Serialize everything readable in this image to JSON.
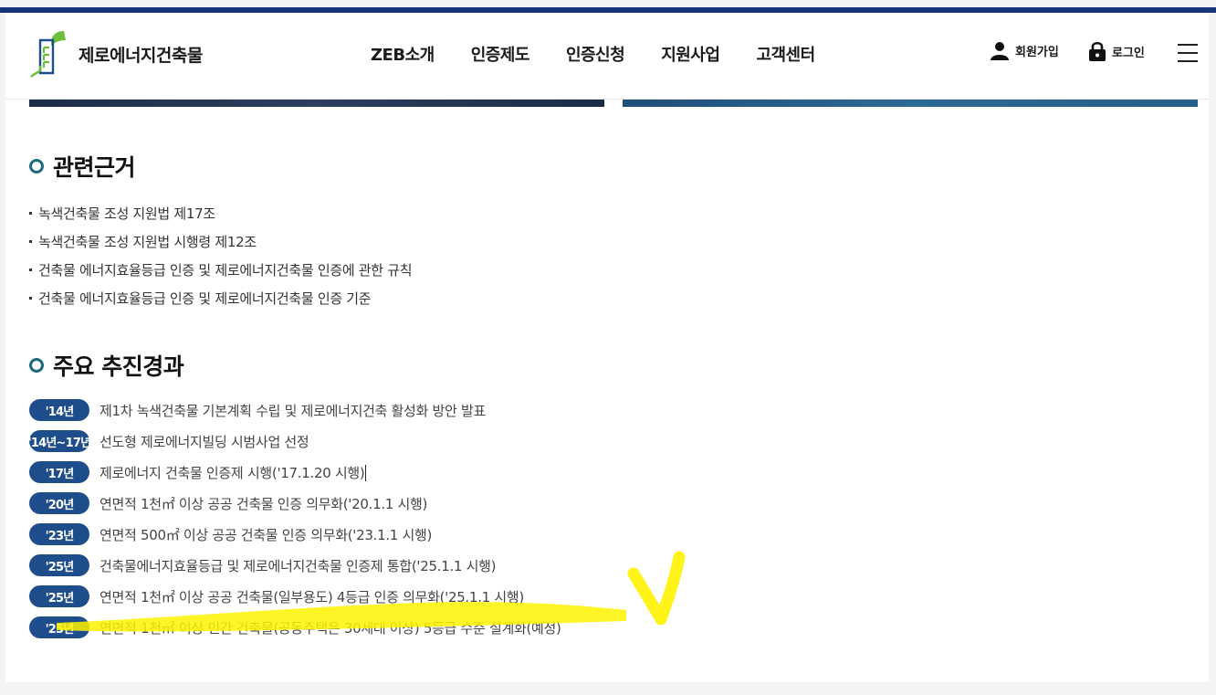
{
  "header": {
    "brand": "제로에너지건축물",
    "nav": [
      "ZEB소개",
      "인증제도",
      "인증신청",
      "지원사업",
      "고객센터"
    ],
    "signup_label": "회원가입",
    "login_label": "로그인"
  },
  "basis": {
    "title": "관련근거",
    "items": [
      "녹색건축물 조성 지원법 제17조",
      "녹색건축물 조성 지원법 시행령 제12조",
      "건축물 에너지효율등급 인증 및 제로에너지건축물 인증에 관한 규칙",
      "건축물 에너지효율등급 인증 및 제로에너지건축물 인증 기준"
    ]
  },
  "history": {
    "title": "주요 추진경과",
    "items": [
      {
        "year": "'14년",
        "desc": "제1차 녹색건축물 기본계획 수립 및 제로에너지건축 활성화 방안 발표"
      },
      {
        "year": "'14년~17년",
        "desc": "선도형 제로에너지빌딩 시범사업 선정"
      },
      {
        "year": "'17년",
        "desc": "제로에너지 건축물 인증제 시행('17.1.20 시행)"
      },
      {
        "year": "'20년",
        "desc": "연면적 1천㎡ 이상 공공 건축물 인증 의무화('20.1.1 시행)"
      },
      {
        "year": "'23년",
        "desc": "연면적 500㎡ 이상 공공 건축물 인증 의무화('23.1.1 시행)"
      },
      {
        "year": "'25년",
        "desc": "건축물에너지효율등급 및 제로에너지건축물 인증제 통합('25.1.1 시행)"
      },
      {
        "year": "'25년",
        "desc": "연면적 1천㎡ 이상 공공 건축물(일부용도) 4등급 인증 의무화('25.1.1 시행)"
      },
      {
        "year": "'25년",
        "desc": "연면적 1천㎡ 이상 민간 건축물(공동주택은 30세대 이상) 5등급 수준 설계화(예정)"
      }
    ]
  },
  "colors": {
    "top_bar": "#16357a",
    "pill": "#1e4d8c",
    "bullet_ring": "#1d6a7a",
    "highlight": "#fff200"
  }
}
